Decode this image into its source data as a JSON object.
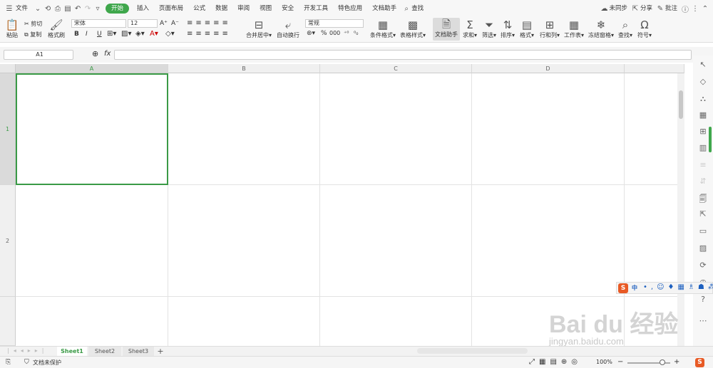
{
  "menu": {
    "file": "文件",
    "tabs": [
      "开始",
      "插入",
      "页面布局",
      "公式",
      "数据",
      "审阅",
      "视图",
      "安全",
      "开发工具",
      "特色应用",
      "文档助手"
    ],
    "search": "查找",
    "sync": "未同步",
    "share": "分享",
    "comment": "批注"
  },
  "ribbon": {
    "paste": "粘贴",
    "cut": "剪切",
    "copy": "复制",
    "format_painter": "格式刷",
    "font": "宋体",
    "size": "12",
    "bold": "B",
    "italic": "I",
    "underline": "U",
    "merge": "合并居中",
    "wrap": "自动换行",
    "number_format": "常规",
    "cond_format": "条件格式",
    "table_style": "表格样式",
    "doc_helper": "文档助手",
    "sum": "求和",
    "filter": "筛选",
    "sort": "排序",
    "format": "格式",
    "rowcol": "行和列",
    "sheet": "工作表",
    "freeze": "冻结窗格",
    "find": "查找",
    "symbol": "符号",
    "percent": "%",
    "thousands": "000"
  },
  "formula": {
    "cell_ref": "A1",
    "fx": "fx",
    "value": ""
  },
  "columns": [
    "A",
    "B",
    "C",
    "D"
  ],
  "rows": [
    "1",
    "2"
  ],
  "sheets": [
    "Sheet1",
    "Sheet2",
    "Sheet3"
  ],
  "add_sheet": "+",
  "status": {
    "protect": "文档未保护",
    "zoom": "100%"
  },
  "ime": {
    "lang": "中"
  },
  "watermark": {
    "brand": "Bai du 经验",
    "url": "jingyan.baidu.com"
  },
  "colors": {
    "accent": "#3fa74c",
    "selection": "#3a9a46"
  }
}
